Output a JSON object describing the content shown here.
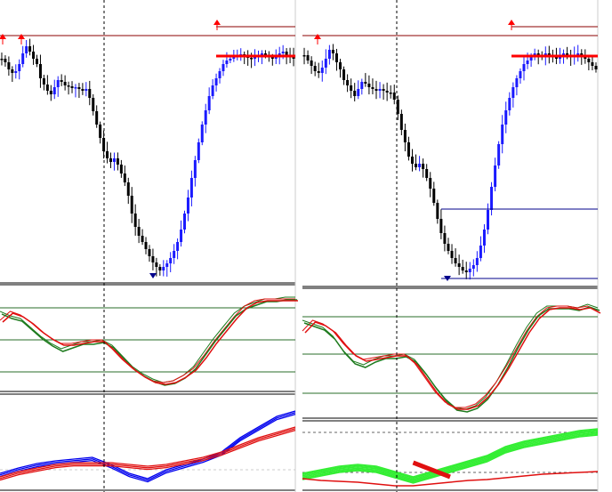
{
  "colors": {
    "background": "#ffffff",
    "bull_candle": "#1a1aff",
    "bear_candle": "#000000",
    "resistance_line": "#8b0000",
    "level_thick": "#ff0000",
    "level_blue": "#00008b",
    "arrow": "#ff0000",
    "stoch_green": "#1e7b1e",
    "stoch_red": "#e01010",
    "stoch_level": "#2a6e2a",
    "osc_blue": "#0000ee",
    "osc_red": "#e01010",
    "osc_bright_green": "#33ee33",
    "panel_divider": "#000000",
    "vline": "#000000"
  },
  "chart_data": [
    {
      "type": "candlestick",
      "panel": "left-price",
      "close_path": [
        66,
        70,
        78,
        82,
        80,
        72,
        60,
        52,
        58,
        66,
        72,
        88,
        95,
        102,
        106,
        98,
        90,
        92,
        96,
        97,
        99,
        98,
        100,
        102,
        100,
        110,
        125,
        140,
        155,
        170,
        178,
        182,
        178,
        185,
        195,
        205,
        220,
        240,
        255,
        265,
        272,
        280,
        288,
        295,
        300,
        304,
        300,
        296,
        290,
        282,
        272,
        258,
        240,
        222,
        200,
        180,
        160,
        140,
        124,
        108,
        96,
        88,
        80,
        72,
        68,
        66,
        64,
        62,
        61,
        63,
        65,
        66,
        64,
        62,
        60,
        62,
        64,
        66,
        62,
        60,
        58,
        62,
        64,
        66
      ],
      "tops": [
        40,
        40
      ],
      "bottom": [
        308
      ],
      "level_thick": 63
    },
    {
      "type": "candlestick",
      "panel": "right-price",
      "close_path": [
        62,
        68,
        74,
        80,
        82,
        76,
        66,
        56,
        60,
        70,
        78,
        90,
        96,
        102,
        108,
        100,
        92,
        94,
        98,
        100,
        102,
        100,
        102,
        104,
        104,
        112,
        128,
        146,
        160,
        176,
        184,
        188,
        184,
        190,
        200,
        212,
        228,
        246,
        262,
        274,
        282,
        290,
        296,
        300,
        304,
        306,
        302,
        298,
        290,
        276,
        258,
        236,
        210,
        186,
        162,
        140,
        124,
        110,
        98,
        88,
        80,
        72,
        68,
        64,
        60,
        62,
        64,
        60,
        62,
        64,
        66,
        62,
        60,
        62,
        64,
        62,
        60,
        64,
        66,
        70,
        74,
        78
      ],
      "tops": [
        40
      ],
      "bottom": [
        313
      ],
      "level_thick": 63,
      "level_blue_upper": 235,
      "level_blue_lower": 313
    },
    {
      "type": "line",
      "panel": "left-stochastic",
      "levels": [
        346,
        382,
        418
      ],
      "series_green": [
        350,
        355,
        358,
        368,
        378,
        386,
        392,
        388,
        384,
        384,
        382,
        388,
        400,
        412,
        420,
        426,
        430,
        428,
        422,
        412,
        396,
        380,
        366,
        352,
        344,
        340,
        336,
        336,
        334,
        334
      ],
      "series_red": [
        360,
        350,
        354,
        362,
        372,
        380,
        386,
        386,
        384,
        382,
        382,
        392,
        404,
        414,
        422,
        428,
        430,
        428,
        422,
        414,
        400,
        384,
        370,
        356,
        344,
        338,
        336,
        336,
        336,
        336
      ]
    },
    {
      "type": "line",
      "panel": "right-stochastic",
      "levels": [
        356,
        398,
        442
      ],
      "series_green": [
        360,
        364,
        368,
        378,
        394,
        406,
        410,
        404,
        400,
        400,
        398,
        404,
        418,
        434,
        448,
        458,
        460,
        456,
        446,
        430,
        410,
        388,
        368,
        352,
        344,
        344,
        344,
        346,
        342,
        346
      ],
      "series_red": [
        372,
        360,
        364,
        372,
        386,
        398,
        404,
        402,
        400,
        398,
        398,
        408,
        424,
        440,
        452,
        458,
        458,
        454,
        444,
        430,
        412,
        392,
        372,
        356,
        346,
        344,
        344,
        346,
        344,
        350
      ]
    },
    {
      "type": "line",
      "panel": "left-oscillator",
      "series_blue": [
        532,
        526,
        521,
        518,
        516,
        514,
        522,
        532,
        538,
        528,
        522,
        516,
        508,
        492,
        480,
        468,
        462
      ],
      "series_red": [
        536,
        530,
        526,
        522,
        520,
        520,
        520,
        522,
        524,
        522,
        518,
        514,
        508,
        500,
        492,
        486,
        480
      ]
    },
    {
      "type": "line",
      "panel": "right-oscillator",
      "series_green": [
        532,
        528,
        524,
        522,
        524,
        530,
        536,
        530,
        524,
        518,
        512,
        502,
        496,
        492,
        488,
        484,
        482
      ],
      "series_red": [
        538,
        540,
        541,
        542,
        544,
        546,
        546,
        544,
        542,
        540,
        539,
        537,
        535,
        533,
        532,
        531,
        530
      ]
    }
  ]
}
